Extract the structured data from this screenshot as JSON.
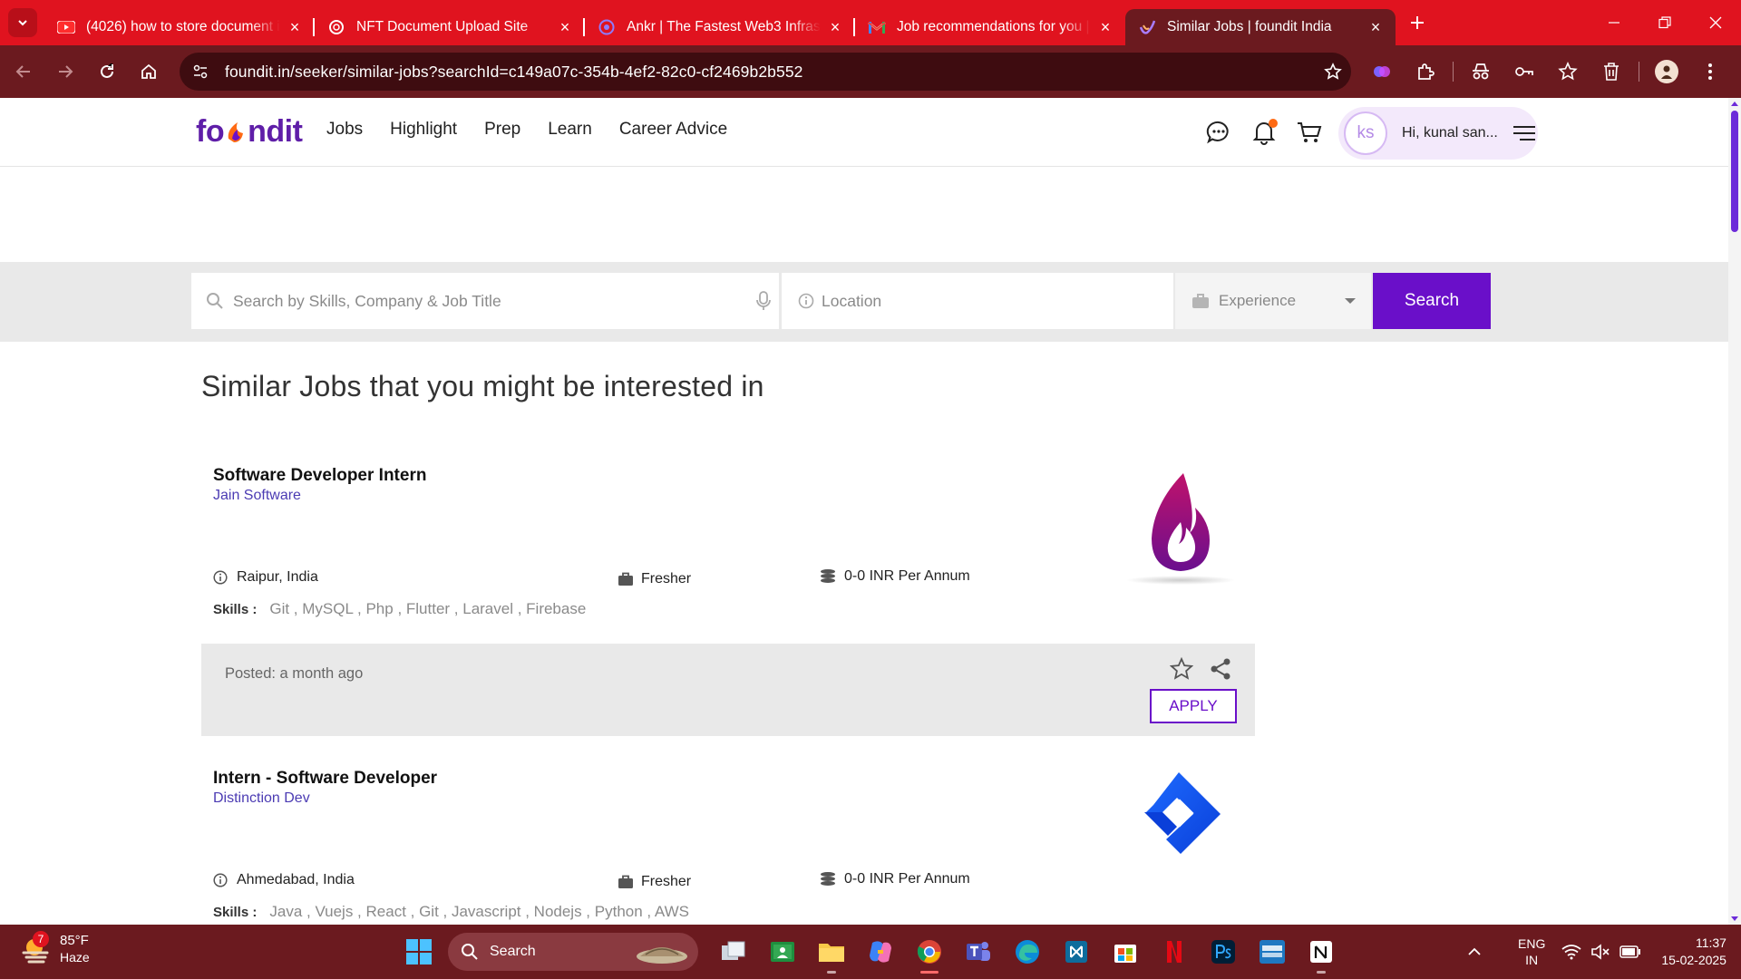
{
  "browser": {
    "tabs": [
      {
        "title": "(4026) how to store document in",
        "icon": "youtube-icon",
        "active": false
      },
      {
        "title": "NFT Document Upload Site",
        "icon": "openai-icon",
        "active": false
      },
      {
        "title": "Ankr | The Fastest Web3 Infrastructure",
        "icon": "ankr-icon",
        "active": false
      },
      {
        "title": "Job recommendations for you |",
        "icon": "gmail-icon",
        "active": false
      },
      {
        "title": "Similar Jobs | foundit India",
        "icon": "foundit-icon",
        "active": true
      }
    ],
    "url": "foundit.in/seeker/similar-jobs?searchId=c149a07c-354b-4ef2-82c0-cf2469b2b552"
  },
  "site": {
    "logo_left": "fo",
    "logo_right": "ndit",
    "nav": [
      "Jobs",
      "Highlight",
      "Prep",
      "Learn",
      "Career Advice"
    ],
    "user": {
      "initials": "ks",
      "greeting": "Hi, kunal san..."
    },
    "brand_color": "#6a0fc9"
  },
  "search": {
    "keyword_placeholder": "Search by Skills, Company & Job Title",
    "location_placeholder": "Location",
    "experience_label": "Experience",
    "button_label": "Search"
  },
  "heading": "Similar Jobs that you might be interested in",
  "jobs": [
    {
      "title": "Software Developer Intern",
      "company": "Jain Software",
      "location": "Raipur, India",
      "experience": "Fresher",
      "salary": "0-0 INR Per Annum",
      "skills_label": "Skills :",
      "skills": "Git , MySQL , Php , Flutter , Laravel , Firebase",
      "posted": "Posted: a month ago",
      "apply_label": "APPLY"
    },
    {
      "title": "Intern - Software Developer",
      "company": "Distinction Dev",
      "location": "Ahmedabad, India",
      "experience": "Fresher",
      "salary": "0-0 INR Per Annum",
      "skills_label": "Skills :",
      "skills": "Java , Vuejs , React , Git , Javascript , Nodejs , Python , AWS"
    }
  ],
  "taskbar": {
    "weather_badge": "7",
    "temperature": "85°F",
    "condition": "Haze",
    "search_label": "Search",
    "lang_top": "ENG",
    "lang_bottom": "IN",
    "time": "11:37",
    "date": "15-02-2025"
  }
}
